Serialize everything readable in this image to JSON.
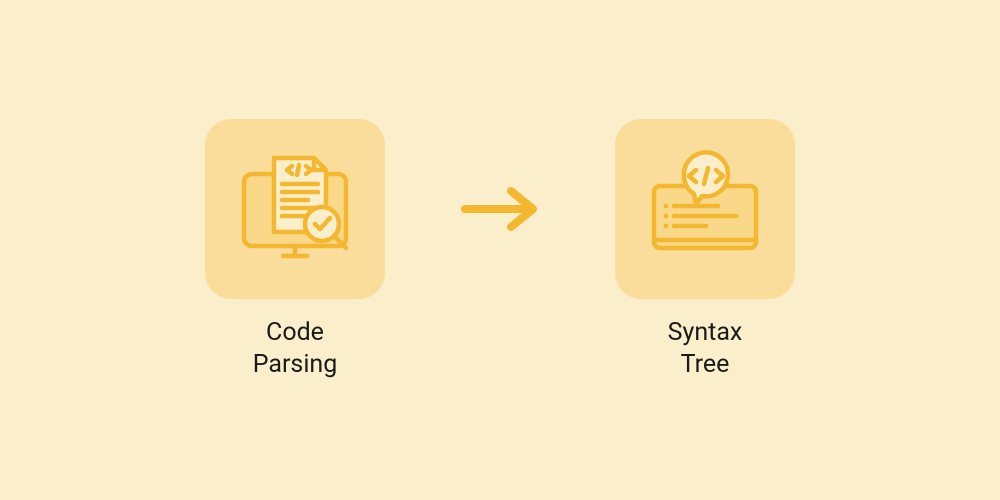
{
  "colors": {
    "background": "#fbeecb",
    "tile": "#fbdd9b",
    "icon_stroke": "#f3b730",
    "icon_fill": "#f9d88a",
    "arrow": "#f3b730",
    "text": "#1a1a1a"
  },
  "nodes": [
    {
      "id": "code-parsing",
      "label": "Code\nParsing",
      "icon": "code-review"
    },
    {
      "id": "syntax-tree",
      "label": "Syntax\nTree",
      "icon": "code-monitor"
    }
  ],
  "arrow": {
    "from": "code-parsing",
    "to": "syntax-tree"
  }
}
